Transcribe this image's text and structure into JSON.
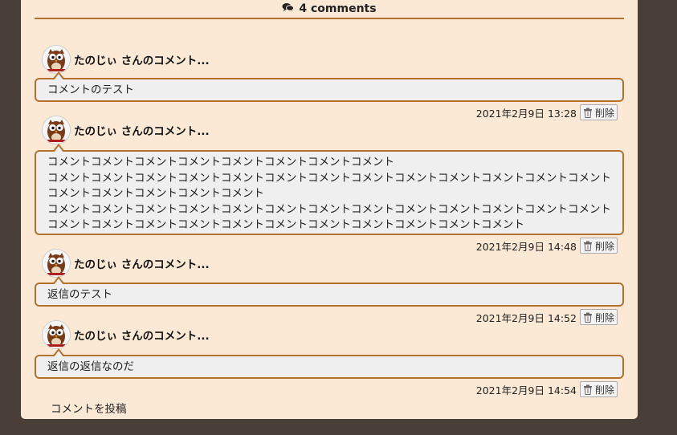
{
  "header": {
    "title": "4 comments",
    "icon": "comments-icon"
  },
  "comments": [
    {
      "author": "たのじぃ さんのコメント...",
      "lines": [
        "コメントのテスト"
      ],
      "date": "2021年2月9日 13:28",
      "delete_label": "削除"
    },
    {
      "author": "たのじぃ さんのコメント...",
      "lines": [
        "コメントコメントコメントコメントコメントコメントコメントコメント",
        "コメントコメントコメントコメントコメントコメントコメントコメントコメントコメントコメントコメントコメントコメントコメントコメントコメントコメント",
        "コメントコメントコメントコメントコメントコメントコメントコメントコメントコメントコメントコメントコメントコメントコメントコメントコメントコメントコメントコメントコメントコメントコメントコメント"
      ],
      "date": "2021年2月9日 14:48",
      "delete_label": "削除"
    },
    {
      "author": "たのじぃ さんのコメント...",
      "lines": [
        "返信のテスト"
      ],
      "date": "2021年2月9日 14:52",
      "delete_label": "削除"
    },
    {
      "author": "たのじぃ さんのコメント...",
      "lines": [
        "返信の返信なのだ"
      ],
      "date": "2021年2月9日 14:54",
      "delete_label": "削除"
    }
  ],
  "footer": {
    "post_comment_label": "コメントを投稿"
  },
  "colors": {
    "background": "#4a3f38",
    "panel": "#fbe8d5",
    "accent": "#b3712f",
    "bubble": "#efefef"
  }
}
